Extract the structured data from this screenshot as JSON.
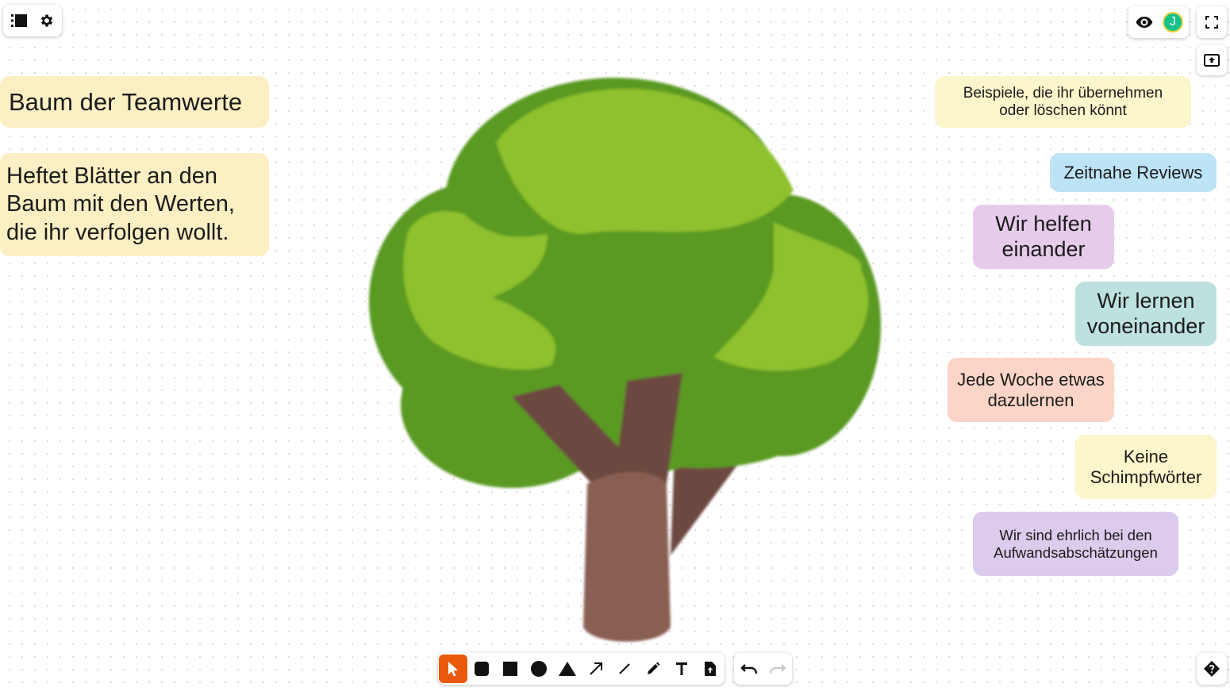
{
  "topbar": {
    "menu_icon": "list-icon",
    "settings_icon": "gear-icon",
    "view_icon": "eye-icon",
    "user_avatar": "J",
    "fullscreen_icon": "fullscreen-icon",
    "export_icon": "upload-icon"
  },
  "board": {
    "title": "Baum der Teamwerte",
    "instruction": "Heftet Blätter an den Baum mit den Werten, die ihr verfolgen wollt.",
    "examples_heading": "Beispiele, die ihr übernehmen oder löschen könnt",
    "values": [
      {
        "text": "Zeitnahe Reviews",
        "color": "#bde3f7"
      },
      {
        "text": "Wir helfen einander",
        "color": "#e6cbeb"
      },
      {
        "text": "Wir lernen voneinander",
        "color": "#bde1df"
      },
      {
        "text": "Jede Woche etwas dazulernen",
        "color": "#fcd5c8"
      },
      {
        "text": "Keine Schimpfwörter",
        "color": "#fcf6cc"
      },
      {
        "text": "Wir sind ehrlich bei den Aufwandsabschätzungen",
        "color": "#dccbec"
      }
    ],
    "note_color_yellow": "#fdefc4",
    "note_color_lightyellow": "#fcf6cc"
  },
  "toolbar": {
    "tools": [
      "select-tool",
      "rounded-rect-tool",
      "rectangle-tool",
      "circle-tool",
      "triangle-tool",
      "arrow-tool",
      "line-tool",
      "pencil-tool",
      "text-tool",
      "file-tool"
    ],
    "active_tool": "select-tool",
    "accent": "#e8590c",
    "undo_icon": "undo-icon",
    "redo_icon": "redo-icon",
    "help_icon": "help-icon"
  },
  "tree": {
    "image": "tree-illustration",
    "leaf_dark": "#5a9a23",
    "leaf_light": "#8fc02f",
    "trunk": "#8a5f52",
    "branch": "#6c4a40"
  }
}
